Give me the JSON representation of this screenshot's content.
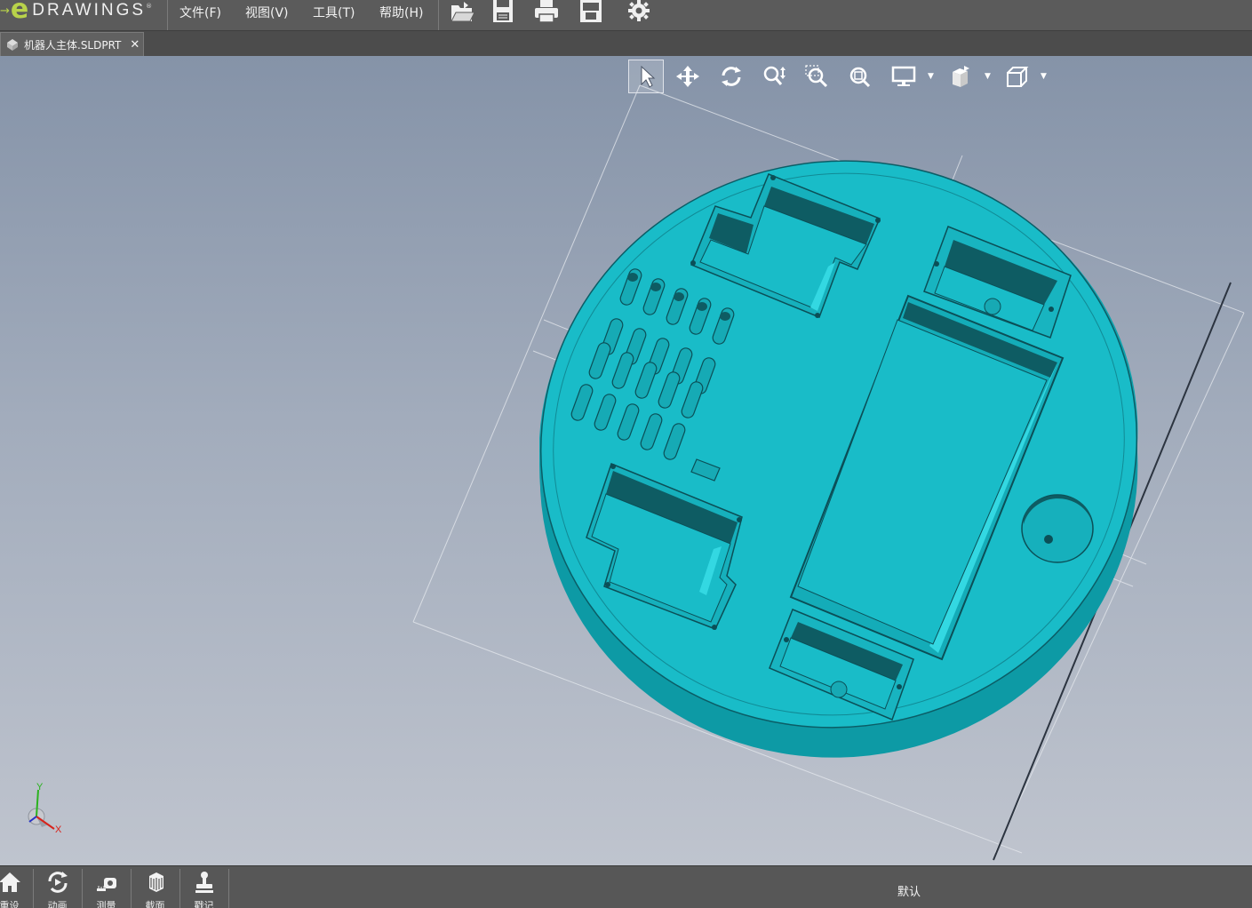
{
  "app": {
    "logo_word": "DRAWINGS",
    "logo_letter": "e",
    "accent_color": "#b8d24a"
  },
  "menu": {
    "items": [
      {
        "label": "文件(F)"
      },
      {
        "label": "视图(V)"
      },
      {
        "label": "工具(T)"
      },
      {
        "label": "帮助(H)"
      }
    ],
    "toolbar_icons": [
      "open-icon",
      "save-icon",
      "print-icon",
      "publish-icon",
      "settings-icon"
    ]
  },
  "tabs": [
    {
      "label": "机器人主体.SLDPRT",
      "close": "✕"
    }
  ],
  "view_toolbar": {
    "icons": [
      "select-icon",
      "pan-icon",
      "rotate-icon",
      "zoom-icon",
      "zoom-to-area-icon",
      "zoom-to-fit-icon",
      "display-style-icon",
      "view-orientation-icon",
      "standard-views-icon"
    ]
  },
  "model": {
    "body_color": "#19bcc8",
    "side_color": "#0fa3ae"
  },
  "triad": {
    "x_label": "X",
    "y_label": "Y"
  },
  "bottom_bar": {
    "buttons": [
      {
        "label": "重设",
        "icon": "home-icon"
      },
      {
        "label": "动画",
        "icon": "animation-icon"
      },
      {
        "label": "测量",
        "icon": "measure-icon"
      },
      {
        "label": "截面",
        "icon": "section-icon"
      },
      {
        "label": "戳记",
        "icon": "stamp-icon"
      }
    ],
    "configuration": "默认"
  }
}
